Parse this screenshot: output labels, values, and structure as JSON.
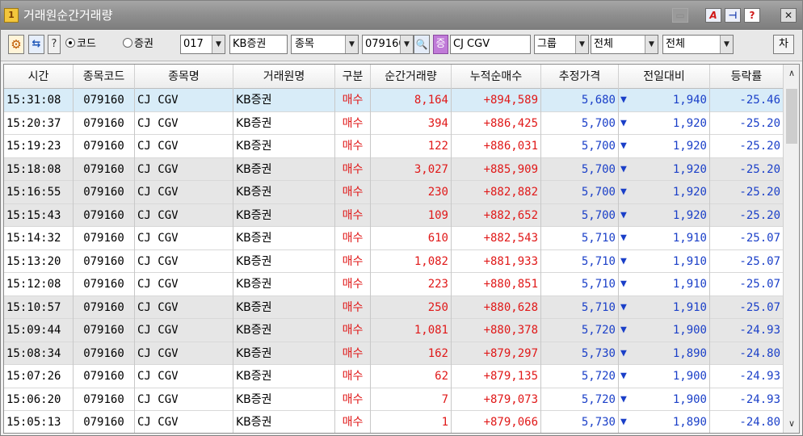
{
  "window": {
    "title": "거래원순간거래량",
    "app_icon_label": "1"
  },
  "titlebar_buttons": {
    "minimize_label": "▭",
    "pdf_label": "A",
    "pin_label": "⊣",
    "help_label": "?",
    "close_label": "✕"
  },
  "toolbar": {
    "gear_icon": "⚙",
    "swap_icon": "⇆",
    "help_label": "?",
    "radio_code_label": "코드",
    "radio_security_label": "증권",
    "broker_code": "017",
    "broker_name": "KB증권",
    "item_select": "종목",
    "stock_code": "079160",
    "search_icon": "🔍",
    "security_badge": "증",
    "stock_name": "CJ CGV",
    "group_select": "그룹",
    "filter1_select": "전체",
    "filter2_select": "전체",
    "next_button": "차"
  },
  "table": {
    "columns": [
      "시간",
      "종목코드",
      "종목명",
      "거래원명",
      "구분",
      "순간거래량",
      "누적순매수",
      "추정가격",
      "전일대비",
      "등락률"
    ],
    "rows": [
      {
        "time": "15:31:08",
        "code": "079160",
        "name": "CJ CGV",
        "broker": "KB증권",
        "type": "매수",
        "volume": "8,164",
        "cumulative": "+894,589",
        "price": "5,680",
        "arrow": "▼",
        "change": "1,940",
        "rate": "-25.46"
      },
      {
        "time": "15:20:37",
        "code": "079160",
        "name": "CJ CGV",
        "broker": "KB증권",
        "type": "매수",
        "volume": "394",
        "cumulative": "+886,425",
        "price": "5,700",
        "arrow": "▼",
        "change": "1,920",
        "rate": "-25.20"
      },
      {
        "time": "15:19:23",
        "code": "079160",
        "name": "CJ CGV",
        "broker": "KB증권",
        "type": "매수",
        "volume": "122",
        "cumulative": "+886,031",
        "price": "5,700",
        "arrow": "▼",
        "change": "1,920",
        "rate": "-25.20"
      },
      {
        "time": "15:18:08",
        "code": "079160",
        "name": "CJ CGV",
        "broker": "KB증권",
        "type": "매수",
        "volume": "3,027",
        "cumulative": "+885,909",
        "price": "5,700",
        "arrow": "▼",
        "change": "1,920",
        "rate": "-25.20"
      },
      {
        "time": "15:16:55",
        "code": "079160",
        "name": "CJ CGV",
        "broker": "KB증권",
        "type": "매수",
        "volume": "230",
        "cumulative": "+882,882",
        "price": "5,700",
        "arrow": "▼",
        "change": "1,920",
        "rate": "-25.20"
      },
      {
        "time": "15:15:43",
        "code": "079160",
        "name": "CJ CGV",
        "broker": "KB증권",
        "type": "매수",
        "volume": "109",
        "cumulative": "+882,652",
        "price": "5,700",
        "arrow": "▼",
        "change": "1,920",
        "rate": "-25.20"
      },
      {
        "time": "15:14:32",
        "code": "079160",
        "name": "CJ CGV",
        "broker": "KB증권",
        "type": "매수",
        "volume": "610",
        "cumulative": "+882,543",
        "price": "5,710",
        "arrow": "▼",
        "change": "1,910",
        "rate": "-25.07"
      },
      {
        "time": "15:13:20",
        "code": "079160",
        "name": "CJ CGV",
        "broker": "KB증권",
        "type": "매수",
        "volume": "1,082",
        "cumulative": "+881,933",
        "price": "5,710",
        "arrow": "▼",
        "change": "1,910",
        "rate": "-25.07"
      },
      {
        "time": "15:12:08",
        "code": "079160",
        "name": "CJ CGV",
        "broker": "KB증권",
        "type": "매수",
        "volume": "223",
        "cumulative": "+880,851",
        "price": "5,710",
        "arrow": "▼",
        "change": "1,910",
        "rate": "-25.07"
      },
      {
        "time": "15:10:57",
        "code": "079160",
        "name": "CJ CGV",
        "broker": "KB증권",
        "type": "매수",
        "volume": "250",
        "cumulative": "+880,628",
        "price": "5,710",
        "arrow": "▼",
        "change": "1,910",
        "rate": "-25.07"
      },
      {
        "time": "15:09:44",
        "code": "079160",
        "name": "CJ CGV",
        "broker": "KB증권",
        "type": "매수",
        "volume": "1,081",
        "cumulative": "+880,378",
        "price": "5,720",
        "arrow": "▼",
        "change": "1,900",
        "rate": "-24.93"
      },
      {
        "time": "15:08:34",
        "code": "079160",
        "name": "CJ CGV",
        "broker": "KB증권",
        "type": "매수",
        "volume": "162",
        "cumulative": "+879,297",
        "price": "5,730",
        "arrow": "▼",
        "change": "1,890",
        "rate": "-24.80"
      },
      {
        "time": "15:07:26",
        "code": "079160",
        "name": "CJ CGV",
        "broker": "KB증권",
        "type": "매수",
        "volume": "62",
        "cumulative": "+879,135",
        "price": "5,720",
        "arrow": "▼",
        "change": "1,900",
        "rate": "-24.93"
      },
      {
        "time": "15:06:20",
        "code": "079160",
        "name": "CJ CGV",
        "broker": "KB증권",
        "type": "매수",
        "volume": "7",
        "cumulative": "+879,073",
        "price": "5,720",
        "arrow": "▼",
        "change": "1,900",
        "rate": "-24.93"
      },
      {
        "time": "15:05:13",
        "code": "079160",
        "name": "CJ CGV",
        "broker": "KB증권",
        "type": "매수",
        "volume": "1",
        "cumulative": "+879,066",
        "price": "5,730",
        "arrow": "▼",
        "change": "1,890",
        "rate": "-24.80"
      }
    ],
    "row_shading": [
      "selected",
      "white",
      "white",
      "gray",
      "gray",
      "gray",
      "white",
      "white",
      "white",
      "gray",
      "gray",
      "gray",
      "white",
      "white",
      "white"
    ]
  },
  "colors": {
    "buy_red": "#e01818",
    "down_blue": "#1a3fc8",
    "selected_row": "#d8ecf8",
    "gray_row": "#e6e6e6"
  },
  "scrollbar": {
    "up_icon": "∧",
    "down_icon": "∨"
  }
}
